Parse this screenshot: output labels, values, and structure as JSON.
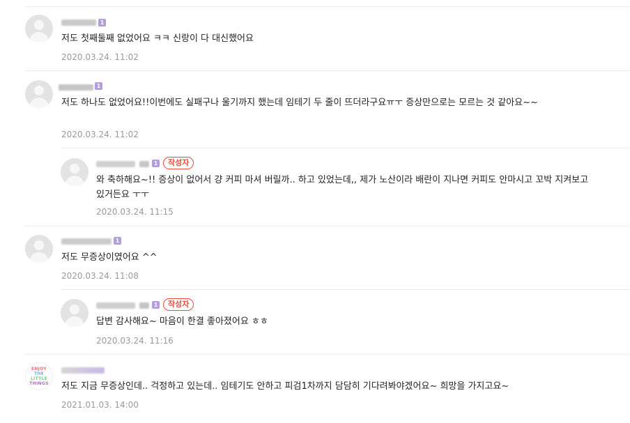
{
  "comments": [
    {
      "level_badge": "1",
      "text": "저도 첫째둘째 없었어요 ㅋㅋ 신랑이 다 대신했어요",
      "date": "2020.03.24. 11:02"
    },
    {
      "level_badge": "1",
      "text": "저도 하나도 없었어요!!이번에도 실패구나 울기까지 했는데 임테기 두 줄이 뜨더라구요ㅠㅜ 증상만으로는 모르는 것 같아요~~",
      "date": "2020.03.24. 11:02"
    },
    {
      "level_badge": "1",
      "author_badge": "작성자",
      "text": "와 축하해요~!! 증상이 없어서 걍 커피 마셔 버릴까.. 하고 있었는데,, 제가 노산이라 배란이 지나면 커피도 안마시고 꼬박 지켜보고 있거든요 ㅜㅜ",
      "date": "2020.03.24. 11:15"
    },
    {
      "level_badge": "1",
      "text": "저도 무증상이였어요 ^^",
      "date": "2020.03.24. 11:08"
    },
    {
      "level_badge": "1",
      "author_badge": "작성자",
      "text": "답변 감사해요~ 마음이 한결 좋아졌어요 ㅎㅎ",
      "date": "2020.03.24. 11:16"
    },
    {
      "avatar_text": [
        "ENJOY",
        "THE",
        "LITTLE",
        "THINGS"
      ],
      "text": "저도 지금 무증상인데.. 걱정하고 있는데.. 임테기도 안하고 피검1차까지 담담히 기다려봐야겠어요~ 희망을 가지고요~",
      "date": "2021.01.03. 14:00"
    }
  ],
  "colors": {
    "level_badge": "#b39ddb",
    "author_badge": "#e74c3c",
    "date": "#9a9a9a",
    "divider": "#ebebeb"
  },
  "icons": {
    "avatar": "default-profile-icon",
    "logo_avatar": "enjoy-the-little-things-logo"
  }
}
